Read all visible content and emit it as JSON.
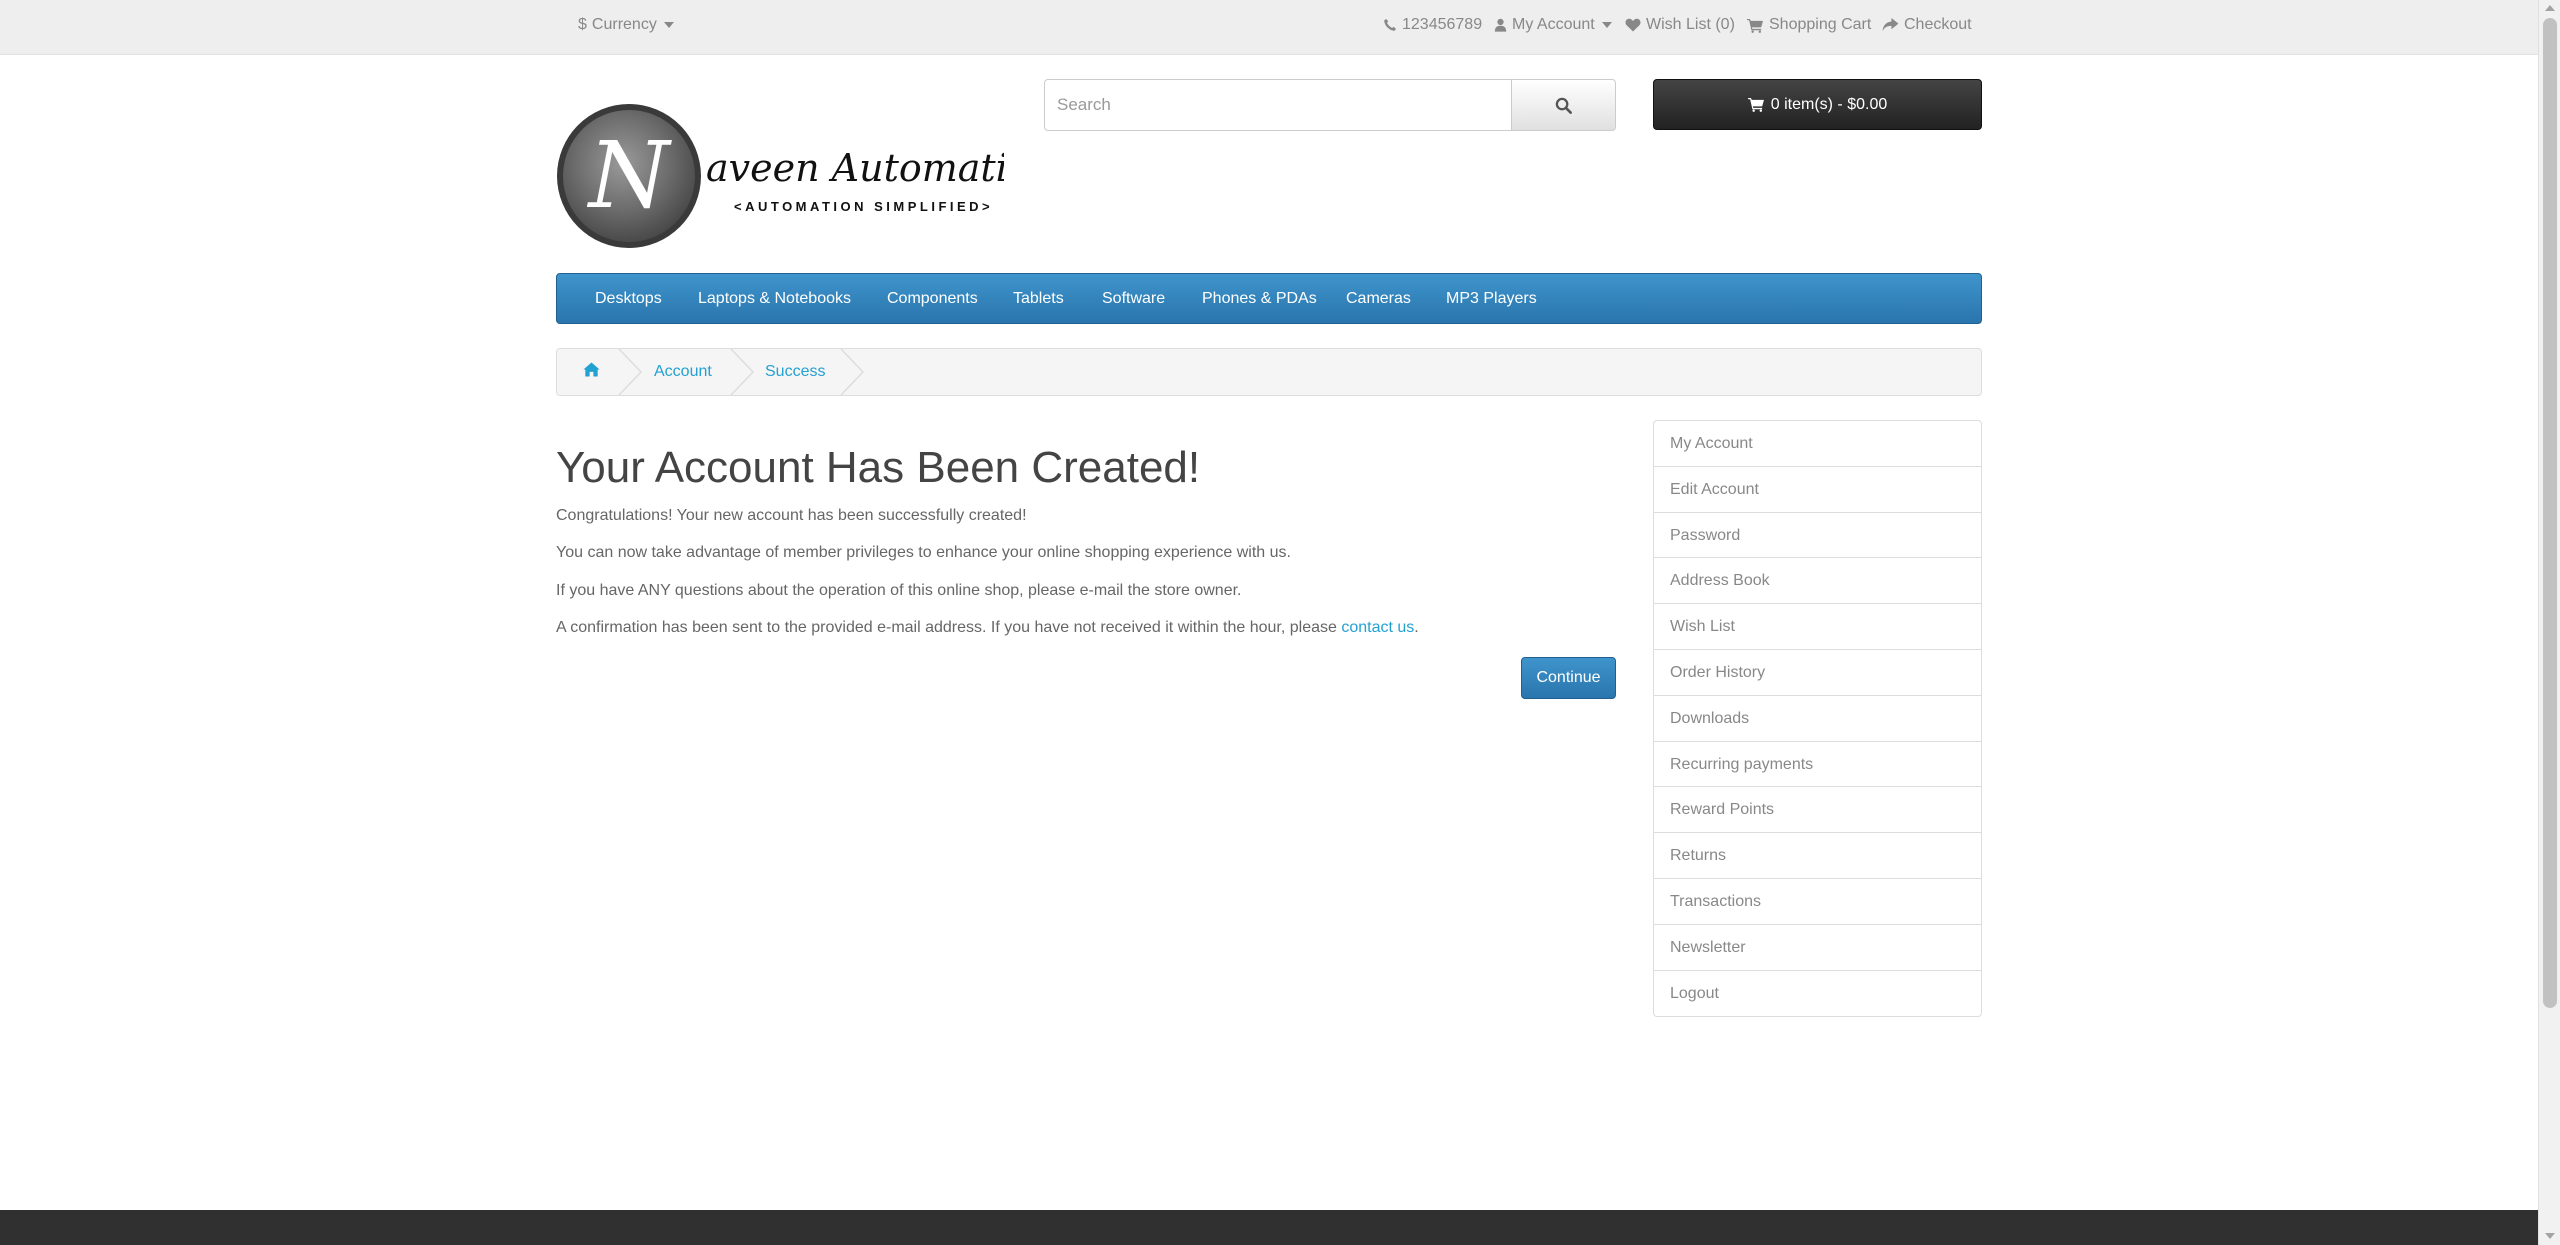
{
  "topbar": {
    "currency_symbol": "$",
    "currency_label": "Currency",
    "phone": "123456789",
    "my_account": "My Account",
    "wishlist": "Wish List (0)",
    "shopping_cart": "Shopping Cart",
    "checkout": "Checkout"
  },
  "header": {
    "logo_text": "aveen Automation Labs",
    "logo_letter": "N",
    "logo_tagline": "<AUTOMATION SIMPLIFIED>",
    "search_placeholder": "Search",
    "cart_label": "0 item(s) - $0.00"
  },
  "menu": {
    "items": [
      "Desktops",
      "Laptops & Notebooks",
      "Components",
      "Tablets",
      "Software",
      "Phones & PDAs",
      "Cameras",
      "MP3 Players"
    ]
  },
  "breadcrumb": {
    "items": [
      "Account",
      "Success"
    ]
  },
  "content": {
    "title": "Your Account Has Been Created!",
    "p1": "Congratulations! Your new account has been successfully created!",
    "p2": "You can now take advantage of member privileges to enhance your online shopping experience with us.",
    "p3": "If you have ANY questions about the operation of this online shop, please e-mail the store owner.",
    "p4_prefix": "A confirmation has been sent to the provided e-mail address. If you have not received it within the hour, please ",
    "p4_link": "contact us",
    "p4_suffix": ".",
    "continue_label": "Continue"
  },
  "sidebar": {
    "items": [
      "My Account",
      "Edit Account",
      "Password",
      "Address Book",
      "Wish List",
      "Order History",
      "Downloads",
      "Recurring payments",
      "Reward Points",
      "Returns",
      "Transactions",
      "Newsletter",
      "Logout"
    ]
  },
  "colors": {
    "menu_blue": "#2f82bf",
    "link_blue": "#23a1d1",
    "cart_black": "#222222",
    "footer_dark": "#303030"
  }
}
